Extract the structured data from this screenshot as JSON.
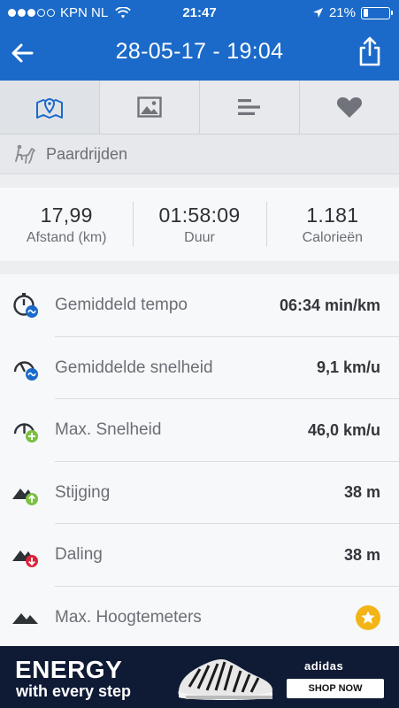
{
  "status_bar": {
    "carrier": "KPN NL",
    "signal_bars_filled": 2,
    "signal_bars_total": 5,
    "time": "21:47",
    "battery_percent": "21%",
    "battery_level": 0.21
  },
  "nav": {
    "title": "28-05-17 - 19:04",
    "back_icon": "arrow-left-icon",
    "share_icon": "share-icon"
  },
  "tabs": [
    {
      "icon": "map-pin-icon",
      "active": true
    },
    {
      "icon": "image-icon",
      "active": false
    },
    {
      "icon": "bars-icon",
      "active": false
    },
    {
      "icon": "heart-icon",
      "active": false
    }
  ],
  "sport": {
    "icon": "horse-riding-icon",
    "label": "Paardrijden"
  },
  "summary": [
    {
      "value": "17,99",
      "label": "Afstand (km)"
    },
    {
      "value": "01:58:09",
      "label": "Duur"
    },
    {
      "value": "1.181",
      "label": "Calorieën"
    }
  ],
  "stats": [
    {
      "label": "Gemiddeld tempo",
      "value": "06:34 min/km",
      "icon": "stopwatch-avg-icon"
    },
    {
      "label": "Gemiddelde snelheid",
      "value": "9,1 km/u",
      "icon": "speedometer-avg-icon"
    },
    {
      "label": "Max. Snelheid",
      "value": "46,0 km/u",
      "icon": "speedometer-max-icon"
    },
    {
      "label": "Stijging",
      "value": "38 m",
      "icon": "mountain-up-icon"
    },
    {
      "label": "Daling",
      "value": "38 m",
      "icon": "mountain-down-icon"
    },
    {
      "label": "Max. Hoogtemeters",
      "value": "",
      "icon": "mountain-icon",
      "badge": "star-icon"
    }
  ],
  "ad": {
    "headline": "ENERGY",
    "subline": "with every step",
    "brand": "adidas",
    "cta": "SHOP NOW"
  },
  "colors": {
    "header": "#1b6ac9",
    "accent_blue": "#1b6ac9",
    "green": "#7bc043",
    "red": "#d9263a",
    "star": "#f2b416"
  }
}
